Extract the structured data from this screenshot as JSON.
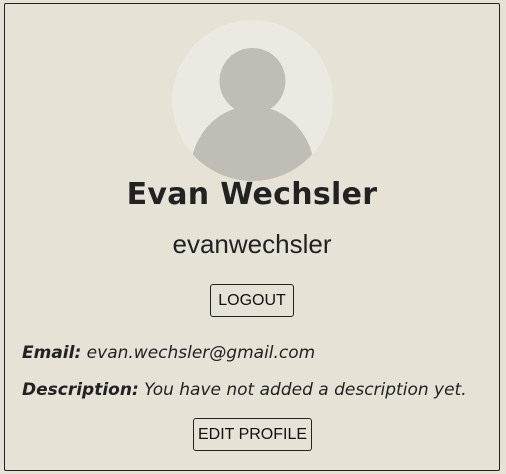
{
  "profile": {
    "name": "Evan Wechsler",
    "username": "evanwechsler",
    "logout_label": "LOGOUT",
    "email_label": "Email:",
    "email_value": "evan.wechsler@gmail.com",
    "description_label": "Description:",
    "description_value": "You have not added a description yet.",
    "edit_label": "EDIT PROFILE",
    "avatar_icon": "default-avatar-icon"
  },
  "colors": {
    "background": "#e6e2d5",
    "avatar_bg": "#ece9e3",
    "avatar_figure": "#c0bdb6",
    "text": "#222222"
  }
}
